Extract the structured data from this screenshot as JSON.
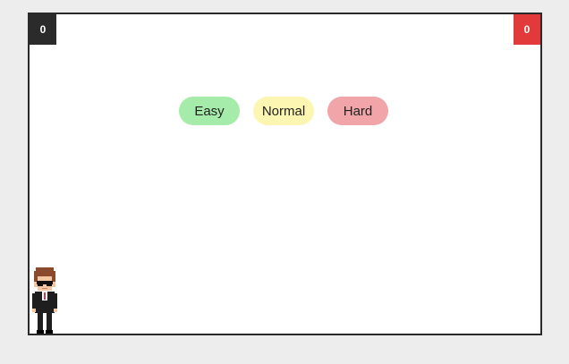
{
  "scoreboard": {
    "player_score": "0",
    "enemy_score": "0"
  },
  "difficulty": {
    "easy_label": "Easy",
    "normal_label": "Normal",
    "hard_label": "Hard"
  },
  "colors": {
    "player_score_bg": "#2b2b2b",
    "enemy_score_bg": "#e23a3a",
    "easy": "#a5ecaa",
    "normal": "#fdf6b2",
    "hard": "#f1a5a9"
  },
  "sprites": {
    "player": "pixel-agent-sunglasses-icon"
  }
}
